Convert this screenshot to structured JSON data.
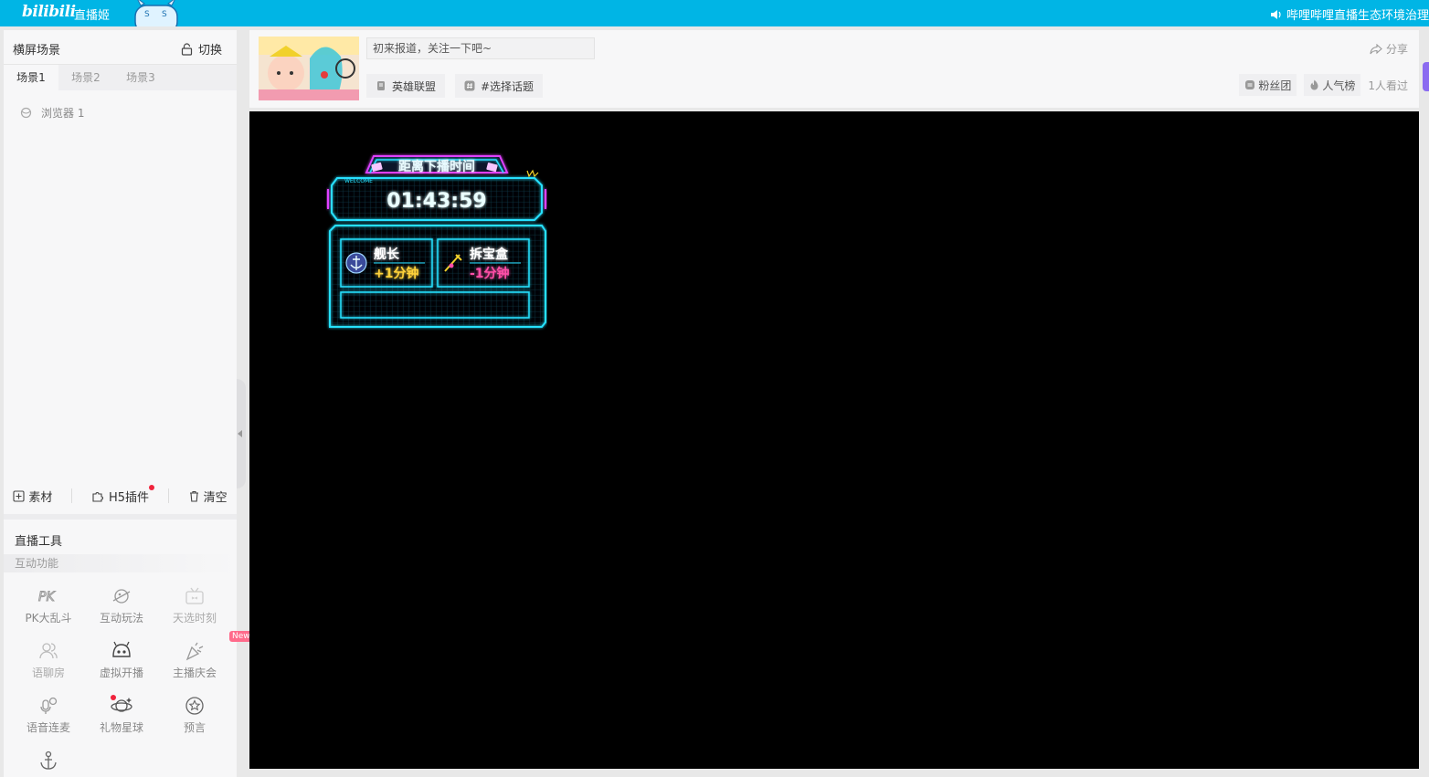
{
  "topbar": {
    "logo": "bilibili",
    "app_name": "直播姬",
    "notice": "哔哩哔哩直播生态环境治理"
  },
  "scene_panel": {
    "title": "横屏场景",
    "switch_label": "切换",
    "tabs": [
      {
        "label": "场景1",
        "active": true
      },
      {
        "label": "场景2",
        "active": false
      },
      {
        "label": "场景3",
        "active": false
      }
    ],
    "sources": [
      {
        "label": "浏览器 1"
      }
    ]
  },
  "source_toolbar": {
    "material_label": "素材",
    "h5_plugin_label": "H5插件",
    "clear_label": "清空"
  },
  "live_tools": {
    "title": "直播工具",
    "section": "互动功能",
    "items": [
      {
        "label": "PK大乱斗",
        "icon": "pk-icon"
      },
      {
        "label": "互动玩法",
        "icon": "planet-icon"
      },
      {
        "label": "天选时刻",
        "icon": "tv-icon"
      },
      {
        "label": "语聊房",
        "icon": "people-icon"
      },
      {
        "label": "虚拟开播",
        "icon": "virtual-avatar-icon"
      },
      {
        "label": "主播庆会",
        "icon": "party-icon",
        "badge": "New"
      },
      {
        "label": "语音连麦",
        "icon": "microphone-icon"
      },
      {
        "label": "礼物星球",
        "icon": "gift-planet-icon"
      },
      {
        "label": "预言",
        "icon": "star-icon"
      },
      {
        "label": "",
        "icon": "anchor-icon"
      }
    ]
  },
  "room": {
    "title_placeholder": "初来报道，关注一下吧~",
    "category_label": "英雄联盟",
    "topic_label": "#选择话题",
    "share_label": "分享",
    "fan_club_label": "粉丝团",
    "popularity_label": "人气榜",
    "viewers_label": "1人看过"
  },
  "overlay_widget": {
    "title": "距离下播时间",
    "welcome": "WELCOME",
    "countdown": "01:43:59",
    "rule_left_name": "舰长",
    "rule_left_value": "+1分钟",
    "rule_right_name": "拆宝盒",
    "rule_right_value": "-1分钟"
  },
  "colors": {
    "topbar": "#00b5e5",
    "neon_cyan": "#27e1ff",
    "neon_magenta": "#e040ff",
    "plus_yellow": "#ffd23a",
    "minus_pink": "#ff4fa8",
    "new_badge": "#ff6b8b",
    "red_dot": "#f0233c"
  }
}
